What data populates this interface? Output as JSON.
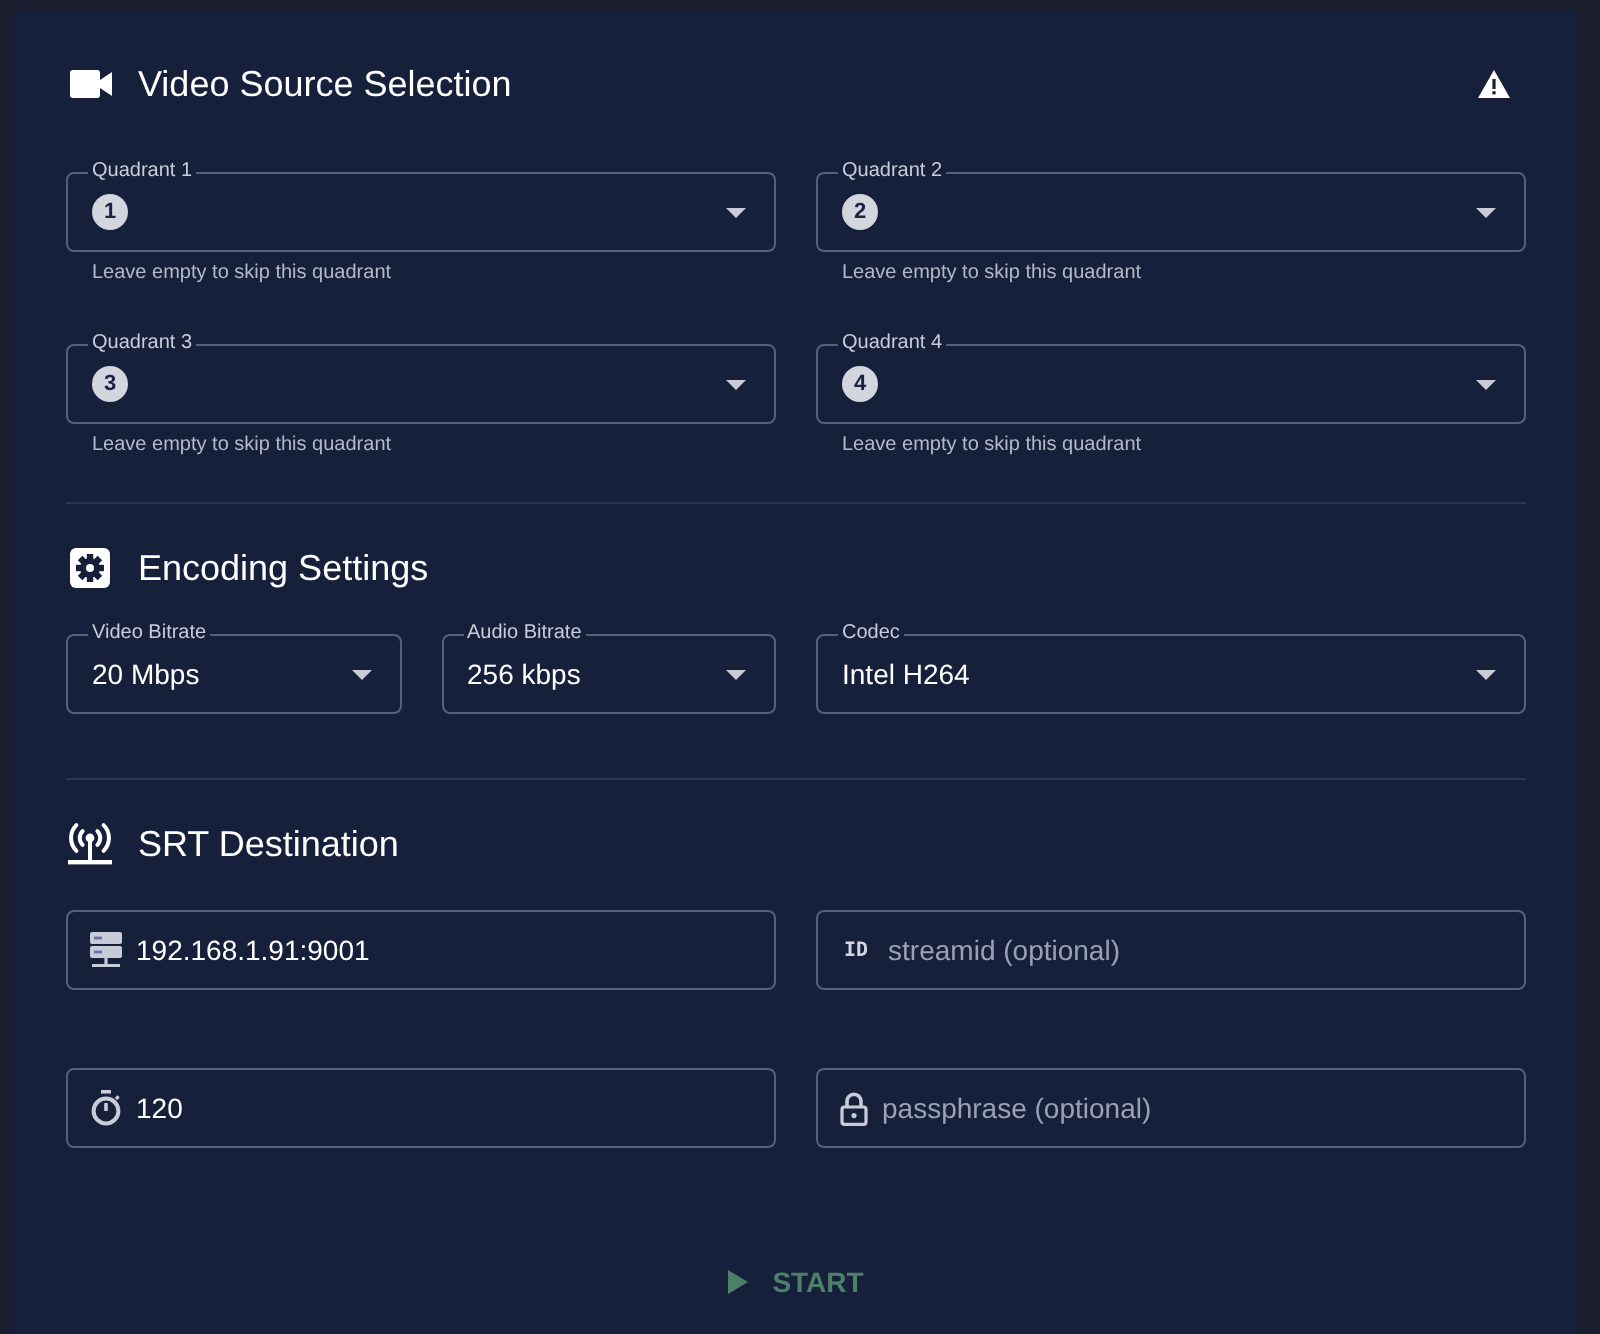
{
  "video_source": {
    "title": "Video Source Selection",
    "quadrants": [
      {
        "label": "Quadrant 1",
        "badge": "1",
        "helper": "Leave empty to skip this quadrant"
      },
      {
        "label": "Quadrant 2",
        "badge": "2",
        "helper": "Leave empty to skip this quadrant"
      },
      {
        "label": "Quadrant 3",
        "badge": "3",
        "helper": "Leave empty to skip this quadrant"
      },
      {
        "label": "Quadrant 4",
        "badge": "4",
        "helper": "Leave empty to skip this quadrant"
      }
    ]
  },
  "encoding": {
    "title": "Encoding Settings",
    "selects": [
      {
        "label": "Video Bitrate",
        "value": "20 Mbps"
      },
      {
        "label": "Audio Bitrate",
        "value": "256 kbps"
      },
      {
        "label": "Codec",
        "value": "Intel H264"
      }
    ]
  },
  "srt": {
    "title": "SRT Destination",
    "fields": [
      {
        "kind": "host",
        "value": "192.168.1.91:9001"
      },
      {
        "kind": "streamid",
        "icon_text": "ID",
        "placeholder": "streamid (optional)"
      },
      {
        "kind": "latency",
        "value": "120"
      },
      {
        "kind": "passphrase",
        "placeholder": "passphrase (optional)"
      }
    ]
  },
  "start_button": {
    "label": "START",
    "disabled": true
  }
}
